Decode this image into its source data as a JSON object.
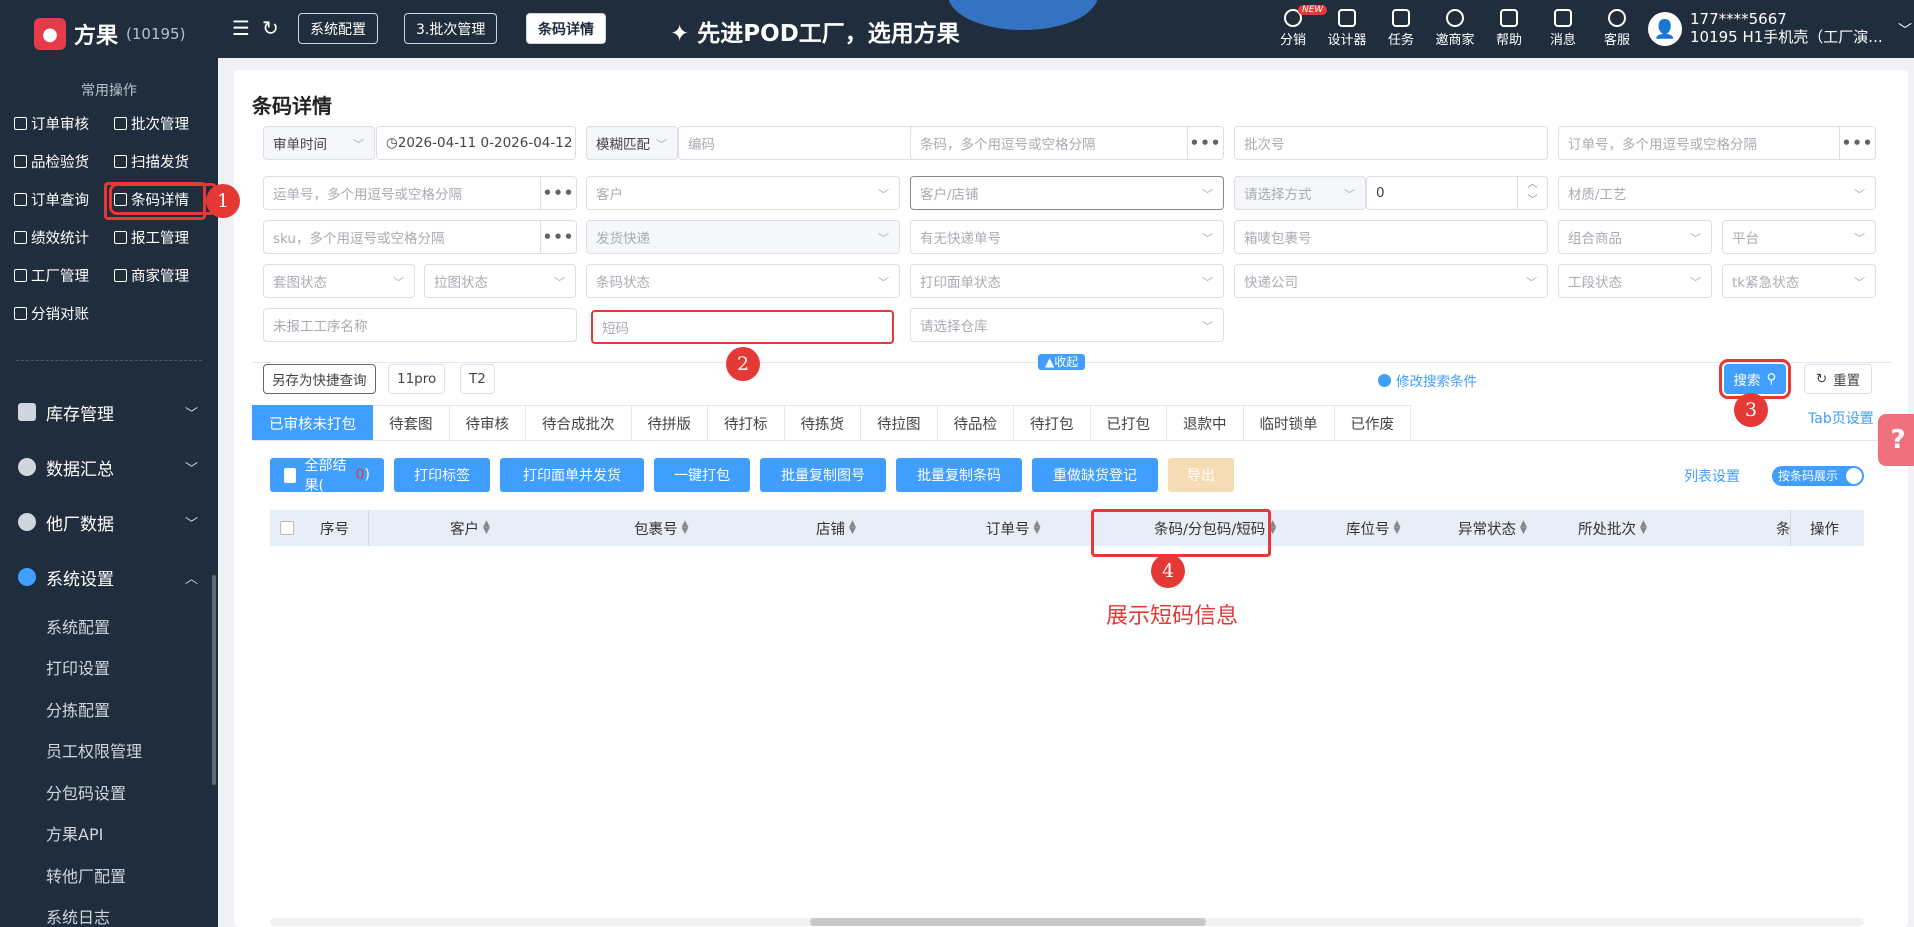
{
  "brand": {
    "name": "方果",
    "id": "(10195)"
  },
  "sidebar": {
    "common_title": "常用操作",
    "quick_ops": [
      "订单审核",
      "批次管理",
      "品检验货",
      "扫描发货",
      "订单查询",
      "条码详情",
      "绩效统计",
      "报工管理",
      "工厂管理",
      "商家管理",
      "分销对账"
    ],
    "groups": [
      "库存管理",
      "数据汇总",
      "他厂数据",
      "系统设置"
    ],
    "submenu": [
      "系统配置",
      "打印设置",
      "分拣配置",
      "员工权限管理",
      "分包码设置",
      "方果API",
      "转他厂配置",
      "系统日志"
    ]
  },
  "topbar": {
    "tabs": [
      "系统配置",
      "3.批次管理",
      "条码详情"
    ],
    "slogan": "先进POD工厂，选用方果",
    "actions": [
      "分销",
      "设计器",
      "任务",
      "邀商家",
      "帮助",
      "消息",
      "客服"
    ],
    "new_badge": "NEW",
    "user_name": "177****5667",
    "user_org": "10195  H1手机壳（工厂演..."
  },
  "page": {
    "title": "条码详情",
    "filters": {
      "audit_time_select": "审单时间",
      "date_range": "2026-04-11 0-2026-04-12 2",
      "fuzzy_select": "模糊匹配",
      "code_placeholder": "编码",
      "barcode_placeholder": "条码，多个用逗号或空格分隔",
      "batch_placeholder": "批次号",
      "order_placeholder": "订单号，多个用逗号或空格分隔",
      "waybill_placeholder": "运单号，多个用逗号或空格分隔",
      "customer_placeholder": "客户",
      "customer_shop_placeholder": "客户/店铺",
      "method_placeholder": "请选择方式",
      "method_value": "0",
      "material_placeholder": "材质/工艺",
      "sku_placeholder": "sku，多个用逗号或空格分隔",
      "shipping_placeholder": "发货快递",
      "has_express_placeholder": "有无快递单号",
      "box_placeholder": "箱唛包裹号",
      "combo_placeholder": "组合商品",
      "platform_placeholder": "平台",
      "set_status_placeholder": "套图状态",
      "pull_status_placeholder": "拉图状态",
      "barcode_status_placeholder": "条码状态",
      "print_status_placeholder": "打印面单状态",
      "express_company_placeholder": "快递公司",
      "stage_status_placeholder": "工段状态",
      "tk_status_placeholder": "tk紧急状态",
      "unreported_placeholder": "未报工工序名称",
      "short_code_placeholder": "短码",
      "warehouse_placeholder": "请选择仓库"
    },
    "collapse_label": "收起",
    "quick_buttons": [
      "另存为快捷查询",
      "11pro",
      "T2"
    ],
    "modify_search": "修改搜索条件",
    "search_label": "搜索",
    "reset_label": "重置",
    "tab_settings": "Tab页设置",
    "tabs": [
      "已审核未打包",
      "待套图",
      "待审核",
      "待合成批次",
      "待拼版",
      "待打标",
      "待拣货",
      "待拉图",
      "待品检",
      "待打包",
      "已打包",
      "退款中",
      "临时锁单",
      "已作废"
    ],
    "actions": {
      "all_results": "全部结果(",
      "all_results_count": "0",
      "all_results_close": ")",
      "print_label": "打印标签",
      "print_ship": "打印面单并发货",
      "one_click_pack": "一键打包",
      "copy_figure": "批量复制图号",
      "copy_barcode": "批量复制条码",
      "redo_shortage": "重做缺货登记",
      "export": "导出"
    },
    "list_settings": "列表设置",
    "barcode_toggle": "按条码展示",
    "columns": [
      "序号",
      "客户",
      "包裹号",
      "店铺",
      "订单号",
      "条码/分包码/短码",
      "库位号",
      "异常状态",
      "所处批次",
      "条",
      "操作"
    ]
  },
  "annotations": {
    "n1": "1",
    "n2": "2",
    "n3": "3",
    "n4": "4",
    "note": "展示短码信息"
  },
  "colors": {
    "accent": "#409eff",
    "sidebar": "#1f2d3d",
    "annotation": "#e53935"
  }
}
